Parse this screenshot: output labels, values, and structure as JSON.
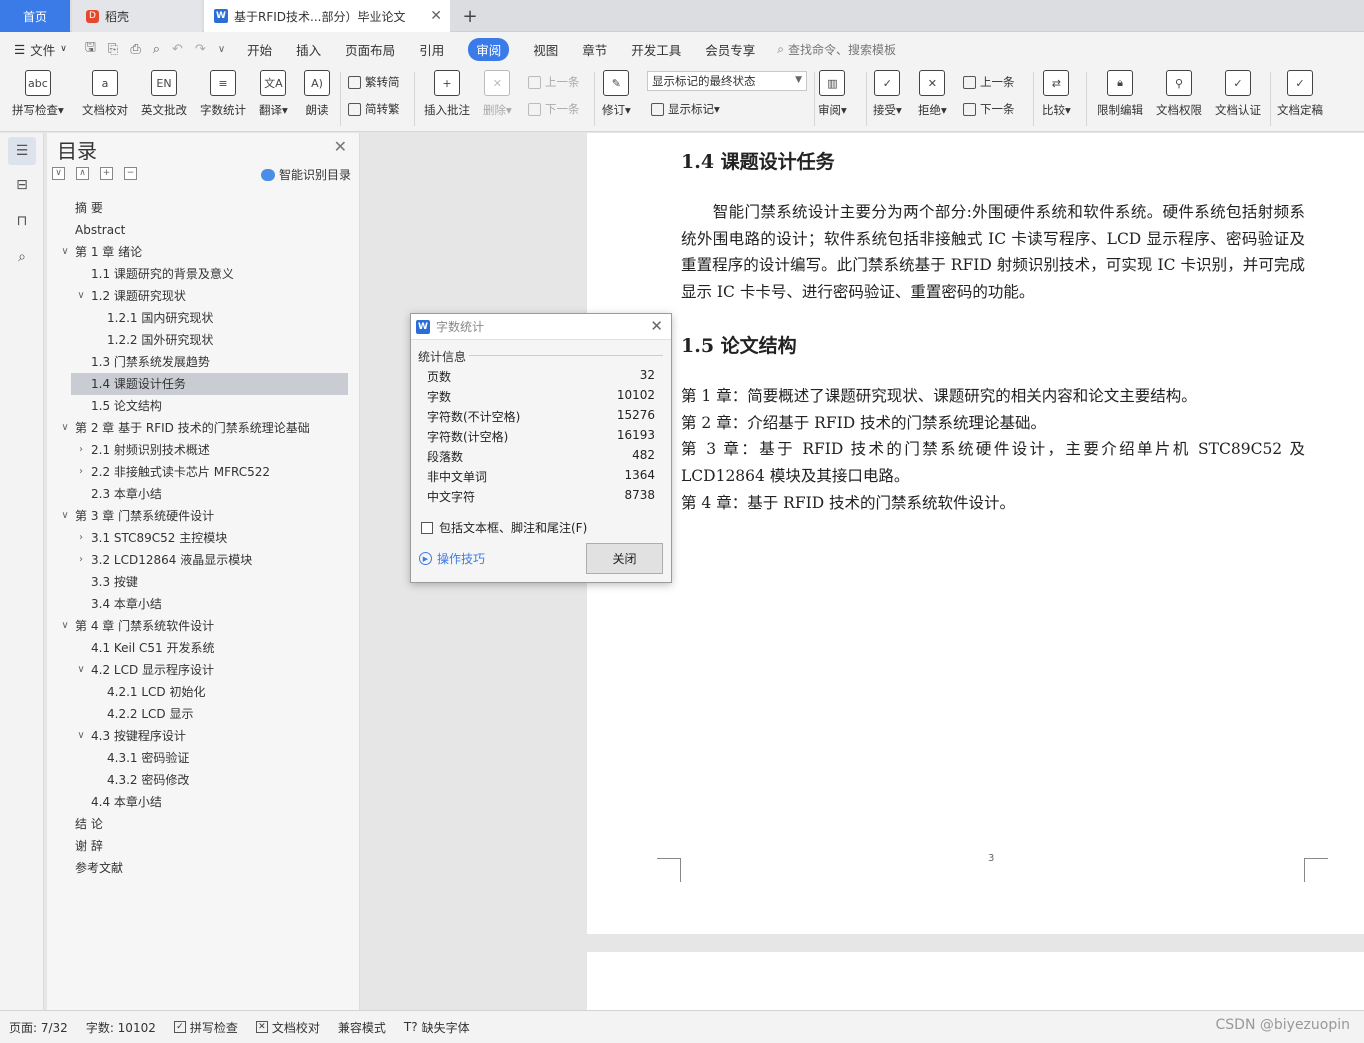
{
  "tabs": {
    "home": "首页",
    "daoke": "稻壳",
    "doc": "基于RFID技术...部分）毕业论文",
    "add": "+"
  },
  "menu": {
    "file": "文件",
    "items": [
      "开始",
      "插入",
      "页面布局",
      "引用",
      "审阅",
      "视图",
      "章节",
      "开发工具",
      "会员专享"
    ],
    "active_index": 4,
    "search": "查找命令、搜索模板"
  },
  "ribbon": {
    "spell_check": "拼写检查",
    "doc_proof": "文档校对",
    "english_review": "英文批改",
    "word_count": "字数统计",
    "translate": "翻译",
    "read_aloud": "朗读",
    "trad": "繁转简",
    "simp": "简转繁",
    "insert_comment": "插入批注",
    "delete": "删除",
    "prev": "上一条",
    "next": "下一条",
    "revise": "修订",
    "markup_state": "显示标记的最终状态",
    "show_markup": "显示标记",
    "review": "审阅",
    "accept": "接受",
    "reject": "拒绝",
    "prev2": "上一条",
    "next2": "下一条",
    "compare": "比较",
    "restrict_edit": "限制编辑",
    "doc_permission": "文档权限",
    "doc_cert": "文档认证",
    "doc_final": "文档定稿"
  },
  "toc": {
    "title": "目录",
    "smart": "智能识别目录",
    "items": [
      {
        "text": "摘  要",
        "level": 0,
        "chev": ""
      },
      {
        "text": "Abstract",
        "level": 0,
        "chev": ""
      },
      {
        "text": "第 1 章  绪论",
        "level": 0,
        "chev": "v"
      },
      {
        "text": "1.1  课题研究的背景及意义",
        "level": 1,
        "chev": ""
      },
      {
        "text": "1.2  课题研究现状",
        "level": 1,
        "chev": "v"
      },
      {
        "text": "1.2.1  国内研究现状",
        "level": 2,
        "chev": ""
      },
      {
        "text": "1.2.2  国外研究现状",
        "level": 2,
        "chev": ""
      },
      {
        "text": "1.3  门禁系统发展趋势",
        "level": 1,
        "chev": ""
      },
      {
        "text": "1.4  课题设计任务",
        "level": 1,
        "chev": "",
        "selected": true
      },
      {
        "text": "1.5  论文结构",
        "level": 1,
        "chev": ""
      },
      {
        "text": "第 2 章  基于 RFID 技术的门禁系统理论基础",
        "level": 0,
        "chev": "v"
      },
      {
        "text": "2.1  射频识别技术概述",
        "level": 1,
        "chev": ">"
      },
      {
        "text": "2.2  非接触式读卡芯片 MFRC522",
        "level": 1,
        "chev": ">"
      },
      {
        "text": "2.3  本章小结",
        "level": 1,
        "chev": ""
      },
      {
        "text": "第 3 章  门禁系统硬件设计",
        "level": 0,
        "chev": "v"
      },
      {
        "text": "3.1 STC89C52 主控模块",
        "level": 1,
        "chev": ">"
      },
      {
        "text": "3.2 LCD12864 液晶显示模块",
        "level": 1,
        "chev": ">"
      },
      {
        "text": "3.3  按键",
        "level": 1,
        "chev": ""
      },
      {
        "text": "3.4  本章小结",
        "level": 1,
        "chev": ""
      },
      {
        "text": "第 4 章  门禁系统软件设计",
        "level": 0,
        "chev": "v"
      },
      {
        "text": "4.1 Keil  C51 开发系统",
        "level": 1,
        "chev": ""
      },
      {
        "text": "4.2 LCD 显示程序设计",
        "level": 1,
        "chev": "v"
      },
      {
        "text": "4.2.1 LCD 初始化",
        "level": 2,
        "chev": ""
      },
      {
        "text": "4.2.2 LCD 显示",
        "level": 2,
        "chev": ""
      },
      {
        "text": "4.3 按键程序设计",
        "level": 1,
        "chev": "v"
      },
      {
        "text": "4.3.1  密码验证",
        "level": 2,
        "chev": ""
      },
      {
        "text": "4.3.2  密码修改",
        "level": 2,
        "chev": ""
      },
      {
        "text": "4.4 本章小结",
        "level": 1,
        "chev": ""
      },
      {
        "text": "结  论",
        "level": 0,
        "chev": ""
      },
      {
        "text": "谢  辞",
        "level": 0,
        "chev": ""
      },
      {
        "text": "参考文献",
        "level": 0,
        "chev": ""
      }
    ]
  },
  "doc": {
    "h14": "1.4  课题设计任务",
    "p14": "　　智能门禁系统设计主要分为两个部分:外围硬件系统和软件系统。硬件系统包括射频系统外围电路的设计；软件系统包括非接触式 IC 卡读写程序、LCD 显示程序、密码验证及重置程序的设计编写。此门禁系统基于 RFID 射频识别技术，可实现 IC 卡识别，并可完成显示 IC 卡卡号、进行密码验证、重置密码的功能。",
    "h15": "1.5  论文结构",
    "c1": "第 1 章：简要概述了课题研究现状、课题研究的相关内容和论文主要结构。",
    "c2": "第 2 章：介绍基于 RFID 技术的门禁系统理论基础。",
    "c3": "第 3 章：基于 RFID 技术的门禁系统硬件设计，主要介绍单片机 STC89C52 及 LCD12864 模块及其接口电路。",
    "c4": "第 4 章：基于 RFID 技术的门禁系统软件设计。",
    "page_number": "3"
  },
  "dialog": {
    "title": "字数统计",
    "section": "统计信息",
    "rows": [
      {
        "label": "页数",
        "value": "32"
      },
      {
        "label": "字数",
        "value": "10102"
      },
      {
        "label": "字符数(不计空格)",
        "value": "15276"
      },
      {
        "label": "字符数(计空格)",
        "value": "16193"
      },
      {
        "label": "段落数",
        "value": "482"
      },
      {
        "label": "非中文单词",
        "value": "1364"
      },
      {
        "label": "中文字符",
        "value": "8738"
      }
    ],
    "checkbox": "包括文本框、脚注和尾注(F)",
    "tips": "操作技巧",
    "close": "关闭"
  },
  "status": {
    "page": "页面: 7/32",
    "words": "字数: 10102",
    "spell": "拼写检查",
    "proof": "文档校对",
    "compat": "兼容模式",
    "missing_font": "缺失字体",
    "watermark": "CSDN @biyezuopin"
  },
  "colors": {
    "accent": "#3b7be8",
    "home_tab": "#3b7be8"
  }
}
